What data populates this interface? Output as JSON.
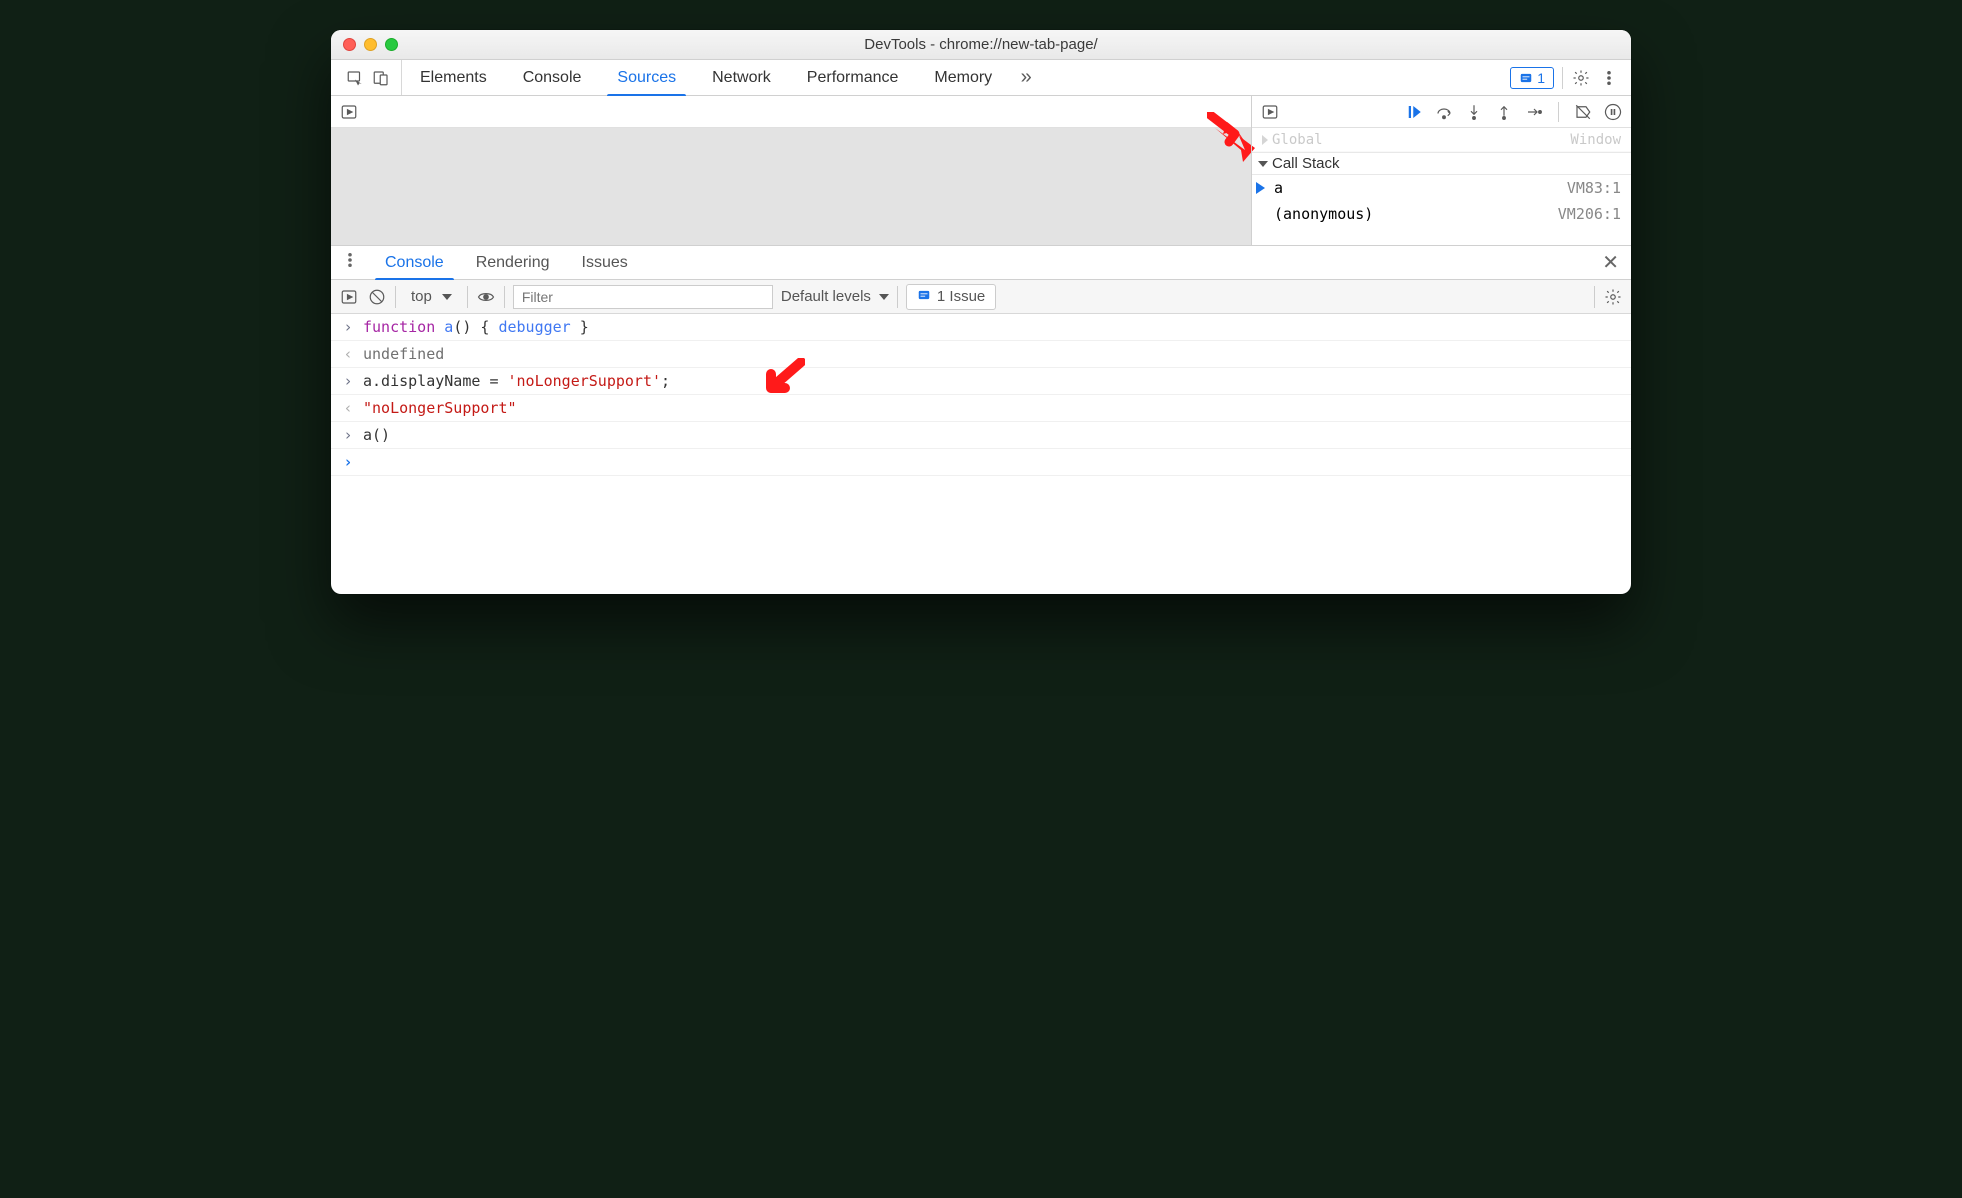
{
  "window": {
    "title": "DevTools - chrome://new-tab-page/"
  },
  "mainTabs": {
    "items": [
      "Elements",
      "Console",
      "Sources",
      "Network",
      "Performance",
      "Memory"
    ],
    "activeIndex": 2,
    "overflow": "»",
    "issuesCount": "1"
  },
  "debugger": {
    "scopeTruncated": {
      "label": "Global",
      "value": "Window"
    },
    "callStack": {
      "title": "Call Stack",
      "frames": [
        {
          "name": "a",
          "location": "VM83:1",
          "active": true
        },
        {
          "name": "(anonymous)",
          "location": "VM206:1",
          "active": false
        }
      ]
    }
  },
  "drawerTabs": {
    "items": [
      "Console",
      "Rendering",
      "Issues"
    ],
    "activeIndex": 0
  },
  "consoleToolbar": {
    "context": "top",
    "filterPlaceholder": "Filter",
    "levels": "Default levels",
    "issueBtn": "1 Issue"
  },
  "consoleLines": [
    {
      "type": "in",
      "html": "<span class='tk-kw'>function</span> <span class='tk-fn'>a</span><span class='tk-punc'>() {</span> <span class='tk-dbg'>debugger</span> <span class='tk-punc'>}</span>"
    },
    {
      "type": "out",
      "html": "<span class='tk-undef'>undefined</span>"
    },
    {
      "type": "in",
      "html": "<span class='tk-nm'>a.displayName</span> <span class='tk-punc'>=</span> <span class='tk-str'>'noLongerSupport'</span><span class='tk-punc'>;</span>"
    },
    {
      "type": "out",
      "html": "<span class='tk-str'>\"noLongerSupport\"</span>"
    },
    {
      "type": "in",
      "html": "<span class='tk-nm'>a()</span>"
    },
    {
      "type": "prompt",
      "html": ""
    }
  ],
  "colors": {
    "accent": "#1a73e8",
    "annotate": "#ff1a1a"
  }
}
